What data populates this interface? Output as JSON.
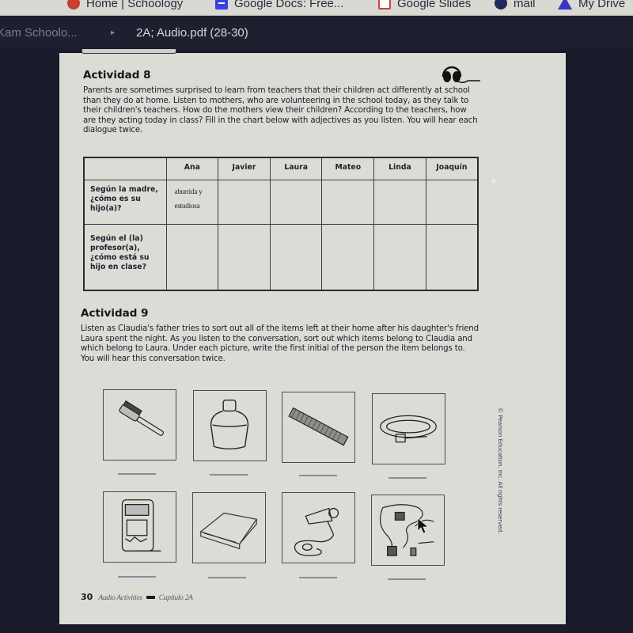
{
  "browser": {
    "bookmarks": [
      {
        "label": "Home | Schoology",
        "icon": "schoology-icon"
      },
      {
        "label": "Google Docs: Free...",
        "icon": "google-docs-icon"
      },
      {
        "label": "Google Slides",
        "icon": "google-slides-icon"
      },
      {
        "label": "mail",
        "icon": "mail-icon"
      },
      {
        "label": "My Drive",
        "icon": "google-drive-icon"
      }
    ]
  },
  "viewer": {
    "breadcrumb_parent": "Kam Schoolo...",
    "breadcrumb_separator": "▸",
    "file_title": "2A; Audio.pdf (28-30)"
  },
  "page": {
    "actividad8": {
      "title": "Actividad 8",
      "icon": "headphones-icon",
      "instructions": "Parents are sometimes surprised to learn from teachers that their children act differently at school than they do at home. Listen to mothers, who are volunteering in the school today, as they talk to their children's teachers. How do the mothers view their children? According to the teachers, how are they acting today in class? Fill in the chart below with adjectives as you listen. You will hear each dialogue twice.",
      "table": {
        "columns": [
          "",
          "Ana",
          "Javier",
          "Laura",
          "Mateo",
          "Linda",
          "Joaquín"
        ],
        "rows": [
          {
            "label": "Según la madre, ¿cómo es su hijo(a)?",
            "cells": [
              "aburrida y estudiosa",
              "",
              "",
              "",
              "",
              ""
            ]
          },
          {
            "label": "Según el (la) profesor(a), ¿cómo está su hijo en clase?",
            "cells": [
              "",
              "",
              "",
              "",
              "",
              ""
            ]
          }
        ]
      }
    },
    "actividad9": {
      "title": "Actividad 9",
      "instructions": "Listen as Claudia's father tries to sort out all of the items left at their home after his daughter's friend Laura spent the night. As you listen to the conversation, sort out which items belong to Claudia and which belong to Laura. Under each picture, write the first initial of the person the item belongs to. You will hear this conversation twice.",
      "pictures": [
        {
          "item": "hairbrush",
          "answer": ""
        },
        {
          "item": "perfume-bottle",
          "answer": ""
        },
        {
          "item": "comb",
          "answer": ""
        },
        {
          "item": "belt",
          "answer": ""
        },
        {
          "item": "portable-music-player",
          "answer": ""
        },
        {
          "item": "towels",
          "answer": ""
        },
        {
          "item": "hair-dryer",
          "answer": ""
        },
        {
          "item": "necklace-jewelry",
          "answer": ""
        }
      ]
    },
    "footer": {
      "page_number": "30",
      "book": "Audio Activities",
      "chapter": "Capítulo 2A"
    },
    "copyright": "© Pearson Education, Inc. All rights reserved."
  }
}
